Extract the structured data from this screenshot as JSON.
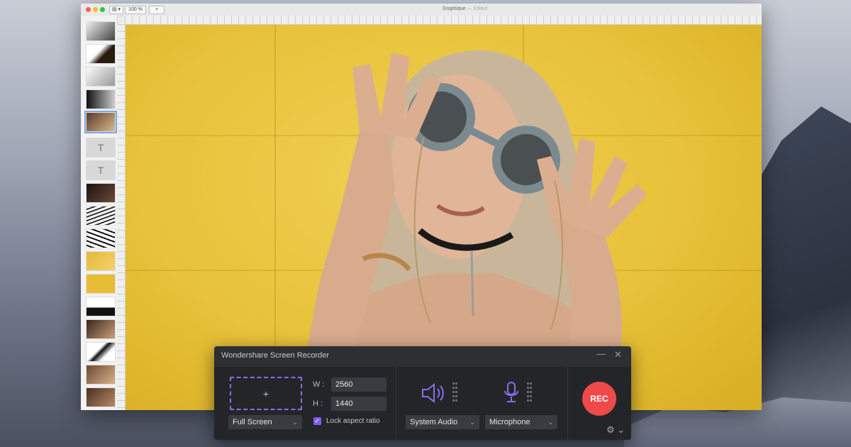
{
  "graphic_window": {
    "title": "Graphique",
    "title_status": "— Edited",
    "zoom": "100 %",
    "add_button": "+",
    "layer_text_thumb": "T"
  },
  "recorder": {
    "title": "Wondershare Screen Recorder",
    "minimize": "—",
    "close": "✕",
    "area_plus": "+",
    "capture_mode": "Full Screen",
    "width_label": "W :",
    "width_value": "2560",
    "height_label": "H :",
    "height_value": "1440",
    "lock_label": "Lock aspect ratio",
    "lock_checked": true,
    "audio_source": "System Audio",
    "mic_source": "Microphone",
    "rec_label": "REC",
    "accent_color": "#8b6ef0",
    "rec_color": "#ee4a4a"
  },
  "icons": {
    "speaker": "speaker-icon",
    "microphone": "microphone-icon",
    "settings": "gear-icon"
  }
}
